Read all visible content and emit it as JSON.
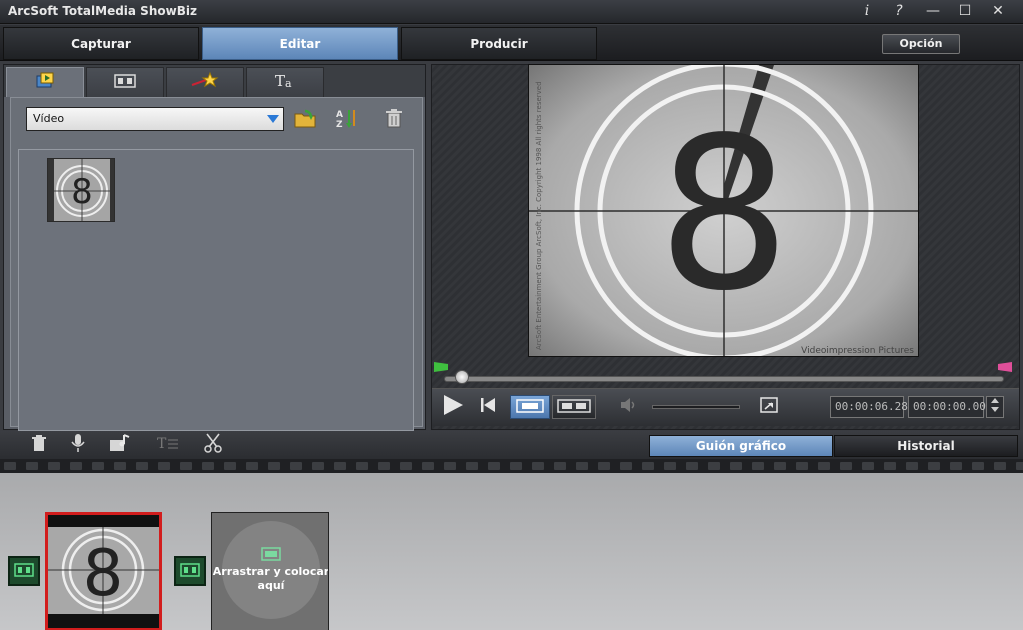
{
  "window": {
    "title": "ArcSoft TotalMedia ShowBiz",
    "controls": {
      "info": "i",
      "help": "?",
      "minimize": "—",
      "maximize": "☐",
      "close": "✕"
    }
  },
  "main_tabs": [
    {
      "label": "Capturar"
    },
    {
      "label": "Editar",
      "active": true
    },
    {
      "label": "Producir"
    }
  ],
  "option_button": "Opción",
  "library": {
    "tabs": [
      {
        "icon": "video-library-icon",
        "active": true
      },
      {
        "icon": "transition-icon"
      },
      {
        "icon": "magic-wand-effects-icon"
      },
      {
        "icon": "text-title-icon"
      }
    ],
    "category": {
      "selected": "Vídeo"
    },
    "toolbar": [
      "import-folder-icon",
      "sort-az-icon",
      "trash-icon"
    ],
    "items": [
      {
        "thumb_number": "8"
      }
    ]
  },
  "preview": {
    "countdown_number": "8",
    "side_text": "ArcSoft Entertainment Group\nArcSoft, Inc. Copyright 1998 All rights reserved",
    "watermark": "Videoimpression Pictures",
    "progress": 0.02,
    "time_current": "00:00:06.28",
    "time_total": "00:00:00.00"
  },
  "bottom_toolbar": {
    "tools": [
      "trash-icon",
      "microphone-icon",
      "music-note-icon",
      "text-icon",
      "scissors-icon"
    ],
    "tabs": [
      {
        "label": "Guión gráfico",
        "active": true
      },
      {
        "label": "Historial"
      }
    ]
  },
  "storyboard": {
    "clip_number": "8",
    "dropzone_text": "Arrastrar y colocar aquí"
  },
  "colors": {
    "accent": "#5d86b8",
    "selection": "#d21d1d",
    "dark": "#2a2c30"
  }
}
